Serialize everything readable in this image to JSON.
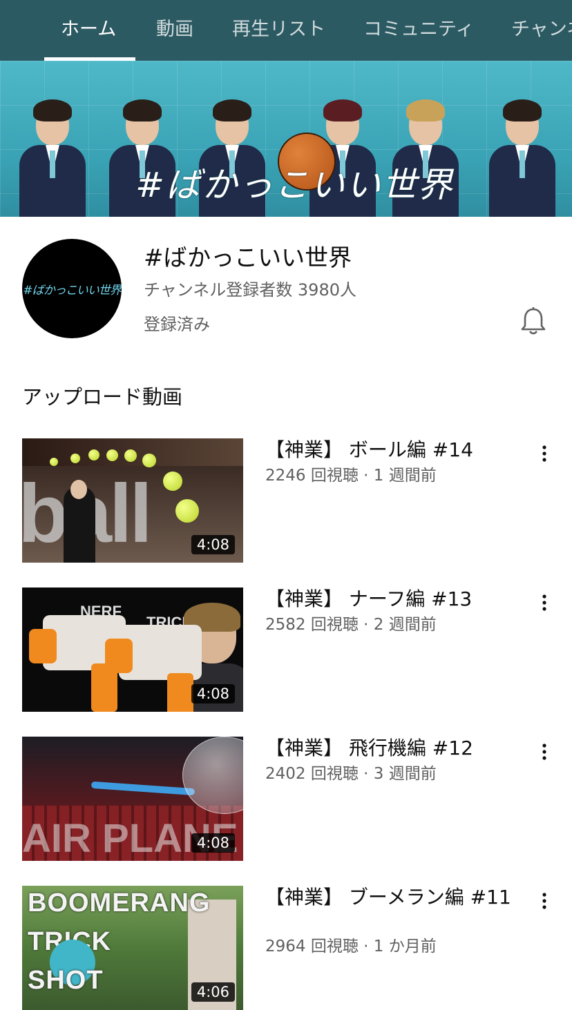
{
  "tabs": [
    {
      "label": "ホーム",
      "active": true
    },
    {
      "label": "動画",
      "active": false
    },
    {
      "label": "再生リスト",
      "active": false
    },
    {
      "label": "コミュニティ",
      "active": false
    },
    {
      "label": "チャンネル",
      "active": false
    }
  ],
  "banner": {
    "title": "#ばかっこいい世界"
  },
  "channel": {
    "avatar_text": "#ばかっこいい世界",
    "name": "#ばかっこいい世界",
    "subscribers": "チャンネル登録者数 3980人",
    "status": "登録済み",
    "bell_icon": "bell-icon"
  },
  "uploads": {
    "title": "アップロード動画",
    "videos": [
      {
        "title": "【神業】 ボール編 #14",
        "views": "2246 回視聴",
        "age": "1 週間前",
        "duration": "4:08"
      },
      {
        "title": "【神業】 ナーフ編 #13",
        "views": "2582 回視聴",
        "age": "2 週間前",
        "duration": "4:08"
      },
      {
        "title": "【神業】 飛行機編 #12",
        "views": "2402 回視聴",
        "age": "3 週間前",
        "duration": "4:08"
      },
      {
        "title": "【神業】 ブーメラン編 #11",
        "views": "2964 回視聴",
        "age": "1 か月前",
        "duration": "4:06"
      }
    ]
  },
  "thumb_text": {
    "v1": "ball",
    "v2_a": "NERF",
    "v2_b": "TRICK",
    "v3": "AIR PLANE",
    "v4_a": "BOOMERANG",
    "v4_b": "TRICK",
    "v4_c": "SHOT"
  },
  "meta_sep": "·",
  "colors": {
    "tabbar": "#2c5a63",
    "banner": "#3aa4b6",
    "secondary_text": "#606060"
  }
}
